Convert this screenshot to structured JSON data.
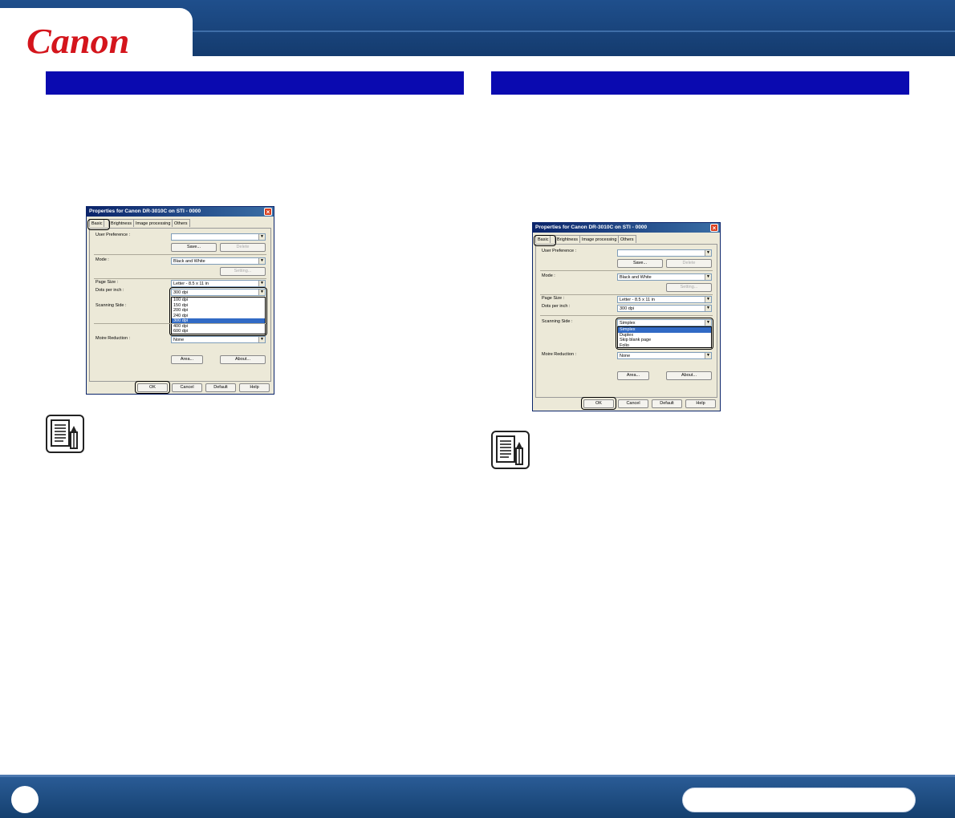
{
  "header": {
    "logo": "Canon"
  },
  "left_dialog": {
    "title": "Properties for Canon DR-3010C on STI - 0000",
    "tabs": [
      "Basic",
      "Brightness",
      "Image processing",
      "Others"
    ],
    "labels": {
      "user_pref": "User Preference :",
      "mode": "Mode :",
      "page_size": "Page Size :",
      "dpi": "Dots per inch :",
      "scan_side": "Scanning Side :",
      "moire": "Moire Reduction :"
    },
    "values": {
      "mode": "Black and White",
      "page_size": "Letter - 8.5 x 11 in",
      "dpi": "300 dpi",
      "moire": "None"
    },
    "dpi_options": [
      "100 dpi",
      "150 dpi",
      "200 dpi",
      "240 dpi",
      "300 dpi",
      "400 dpi",
      "600 dpi"
    ],
    "dpi_selected_index": 4,
    "buttons": {
      "save": "Save...",
      "delete": "Delete",
      "setting": "Setting...",
      "area": "Area...",
      "about": "About...",
      "ok": "OK",
      "cancel": "Cancel",
      "default": "Default",
      "help": "Help"
    }
  },
  "right_dialog": {
    "title": "Properties for Canon DR-3010C on STI - 0000",
    "tabs": [
      "Basic",
      "Brightness",
      "Image processing",
      "Others"
    ],
    "labels": {
      "user_pref": "User Preference :",
      "mode": "Mode :",
      "page_size": "Page Size :",
      "dpi": "Dots per inch :",
      "scan_side": "Scanning Side :",
      "moire": "Moire Reduction :"
    },
    "values": {
      "mode": "Black and White",
      "page_size": "Letter - 8.5 x 11 in",
      "dpi": "300 dpi",
      "scan_side": "Simplex",
      "moire": "None"
    },
    "side_options": [
      "Simplex",
      "Duplex",
      "Skip blank page",
      "Folio"
    ],
    "side_selected_index": 0,
    "buttons": {
      "save": "Save...",
      "delete": "Delete",
      "setting": "Setting...",
      "area": "Area...",
      "about": "About...",
      "ok": "OK",
      "cancel": "Cancel",
      "default": "Default",
      "help": "Help"
    }
  },
  "colors": {
    "header_blue": "#1f4f8c",
    "section_blue": "#0a0ab0",
    "logo_red": "#d4151c"
  },
  "icons": [
    "note-pencil-icon"
  ]
}
